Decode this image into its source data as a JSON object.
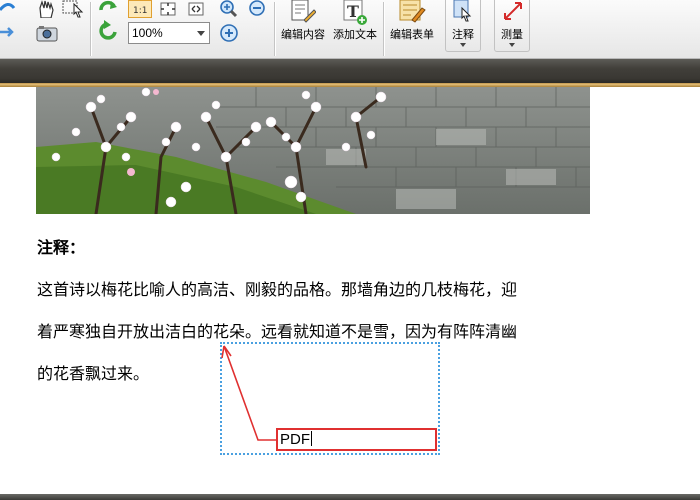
{
  "toolbar": {
    "zoom_value": "100%",
    "edit_content_label": "编辑内容",
    "add_text_label": "添加文本",
    "edit_form_label": "编辑表单",
    "annotate_label": "注释",
    "measure_label": "测量"
  },
  "document": {
    "heading": "注释：",
    "paragraph_lines": [
      "这首诗以梅花比喻人的高洁、刚毅的品格。那墙角边的几枝梅花，迎",
      "着严寒独自开放出洁白的花朵。远看就知道不是雪，因为有阵阵清幽",
      "的花香飘过来。"
    ]
  },
  "annotation": {
    "callout_text": "PDF"
  },
  "colors": {
    "callout_border": "#e03030",
    "callout_leader": "#e03030",
    "selection_frame": "#4aa0e0",
    "accent_band": "#c9a15a"
  }
}
